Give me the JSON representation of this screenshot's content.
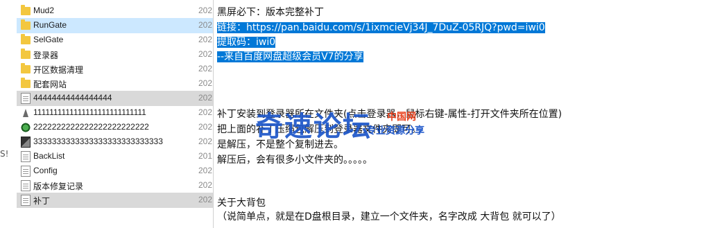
{
  "explorer": {
    "items": [
      {
        "name": "Mud2",
        "date": "202",
        "icon": "folder-icon",
        "state": ""
      },
      {
        "name": "RunGate",
        "date": "202",
        "icon": "folder-icon",
        "state": "sel-light"
      },
      {
        "name": "SelGate",
        "date": "202",
        "icon": "folder-icon",
        "state": ""
      },
      {
        "name": "登录器",
        "date": "202",
        "icon": "folder-icon",
        "state": ""
      },
      {
        "name": "开区数据清理",
        "date": "202",
        "icon": "folder-icon",
        "state": ""
      },
      {
        "name": "配套网站",
        "date": "202",
        "icon": "folder-icon",
        "state": ""
      },
      {
        "name": "44444444444444444",
        "date": "202",
        "icon": "text-file-icon",
        "state": "sel-grey"
      },
      {
        "name": "1111111111111111111111111111",
        "date": "202",
        "icon": "app-icon",
        "state": ""
      },
      {
        "name": "2222222222222222222222222",
        "date": "202",
        "icon": "game-app-icon",
        "state": ""
      },
      {
        "name": "3333333333333333333333333333",
        "date": "202",
        "icon": "dark-app-icon",
        "state": ""
      },
      {
        "name": "BackList",
        "date": "201",
        "icon": "text-file-icon",
        "state": ""
      },
      {
        "name": "Config",
        "date": "202",
        "icon": "config-file-icon",
        "state": ""
      },
      {
        "name": "版本修复记录",
        "date": "202",
        "icon": "text-file-icon",
        "state": ""
      },
      {
        "name": "补丁",
        "date": "202",
        "icon": "text-file-icon",
        "state": "sel-grey"
      }
    ],
    "edge_glyph": "S!"
  },
  "document": {
    "line1": "黑屏必下：版本完整补丁",
    "line2": "链接：https://pan.baidu.com/s/1ixmcieVj34J_7DuZ-05RJQ?pwd=iwi0",
    "line3": "提取码：iwi0",
    "line4": "--来自百度网盘超级会员V7的分享",
    "line5": "补丁安装到登录器所在文件夹(点击登录器，鼠标右键-属性-打开文件夹所在位置)",
    "line6": "把上面的补丁压缩包解压到登录器文件夹即可。",
    "line7": "是解压，不是整个复制进去。",
    "line8": "解压后，会有很多小文件夹的。。。。。",
    "line9": "关于大背包",
    "line10": "（说简单点，就是在D盘根目录，建立一个文件夹，名字改成   大背包     就可以了）"
  },
  "watermark": {
    "main": "奇速论坛",
    "red": "中国网",
    "sub": "专业资源分享"
  }
}
